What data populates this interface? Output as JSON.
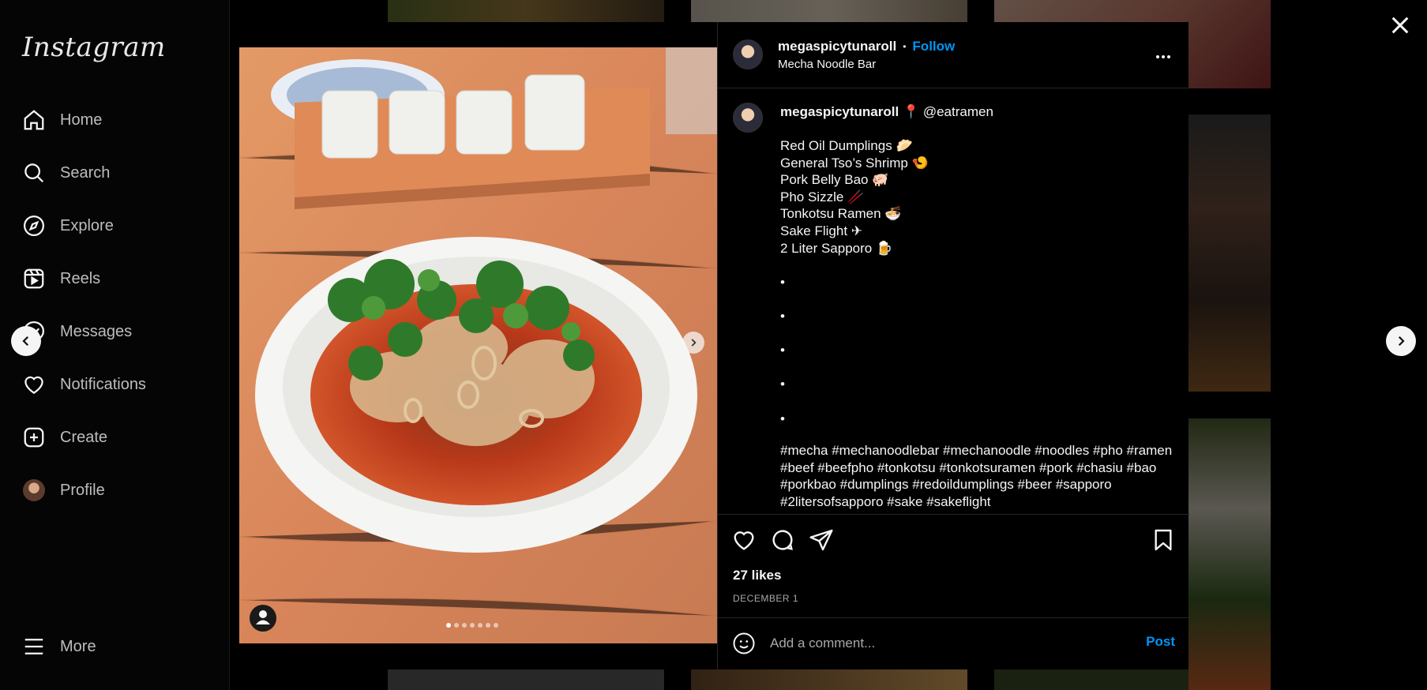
{
  "sidebar": {
    "logo": "Instagram",
    "items": [
      {
        "label": "Home",
        "icon": "home-icon"
      },
      {
        "label": "Search",
        "icon": "search-icon"
      },
      {
        "label": "Explore",
        "icon": "compass-icon"
      },
      {
        "label": "Reels",
        "icon": "reels-icon"
      },
      {
        "label": "Messages",
        "icon": "messenger-icon"
      },
      {
        "label": "Notifications",
        "icon": "heart-icon"
      },
      {
        "label": "Create",
        "icon": "plus-square-icon"
      },
      {
        "label": "Profile",
        "icon": "avatar-icon"
      }
    ],
    "more_label": "More"
  },
  "post": {
    "header": {
      "username": "megaspicytunaroll",
      "separator": "•",
      "follow_label": "Follow",
      "location": "Mecha Noodle Bar"
    },
    "caption": {
      "username": "megaspicytunaroll",
      "mention": "📍 @eatramen",
      "lines": [
        "Red Oil Dumplings 🥟",
        "General Tso’s Shrimp 🍤",
        "Pork Belly Bao 🐖",
        "Pho Sizzle 🥢",
        "Tonkotsu Ramen 🍜",
        "Sake Flight ✈",
        "2 Liter Sapporo 🍺",
        "",
        "•",
        "",
        "•",
        "",
        "•",
        "",
        "•",
        "",
        "•"
      ],
      "hashtags": "#mecha #mechanoodlebar #mechanoodle #noodles #pho #ramen #beef #beefpho #tonkotsu #tonkotsuramen #pork #chasiu #bao #porkbao #dumplings #redoildumplings #beer #sapporo #2litersofsapporo #sake #sakeflight"
    },
    "likes": "27 likes",
    "date": "DECEMBER 1",
    "comment_placeholder": "Add a comment...",
    "post_label": "Post",
    "carousel": {
      "count": 7,
      "active": 0
    }
  },
  "colors": {
    "accent": "#0095f6",
    "background": "#000000",
    "border": "#262626",
    "secondary_text": "#a8a8a8"
  }
}
